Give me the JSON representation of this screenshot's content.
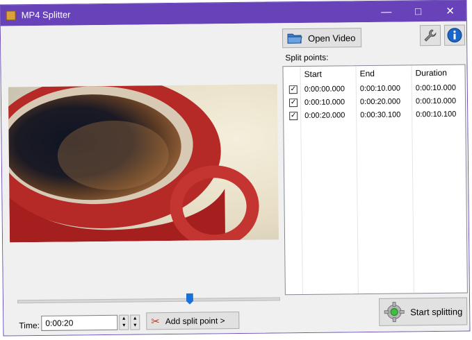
{
  "window": {
    "title": "MP4 Splitter"
  },
  "toolbar": {
    "open_video_label": "Open Video"
  },
  "split_points": {
    "label": "Split points:",
    "columns": [
      "Start",
      "End",
      "Duration"
    ],
    "rows": [
      {
        "checked": true,
        "start": "0:00:00.000",
        "end": "0:00:10.000",
        "duration": "0:00:10.000"
      },
      {
        "checked": true,
        "start": "0:00:10.000",
        "end": "0:00:20.000",
        "duration": "0:00:10.000"
      },
      {
        "checked": true,
        "start": "0:00:20.000",
        "end": "0:00:30.100",
        "duration": "0:00:10.100"
      }
    ]
  },
  "timeline": {
    "position_fraction": 0.66
  },
  "time": {
    "label": "Time:",
    "value": "0:00:20"
  },
  "actions": {
    "add_split_label": "Add split point >",
    "start_label": "Start splitting"
  },
  "colors": {
    "titlebar": "#6842b8",
    "slider_thumb": "#1a72d8",
    "info": "#1866c8"
  }
}
